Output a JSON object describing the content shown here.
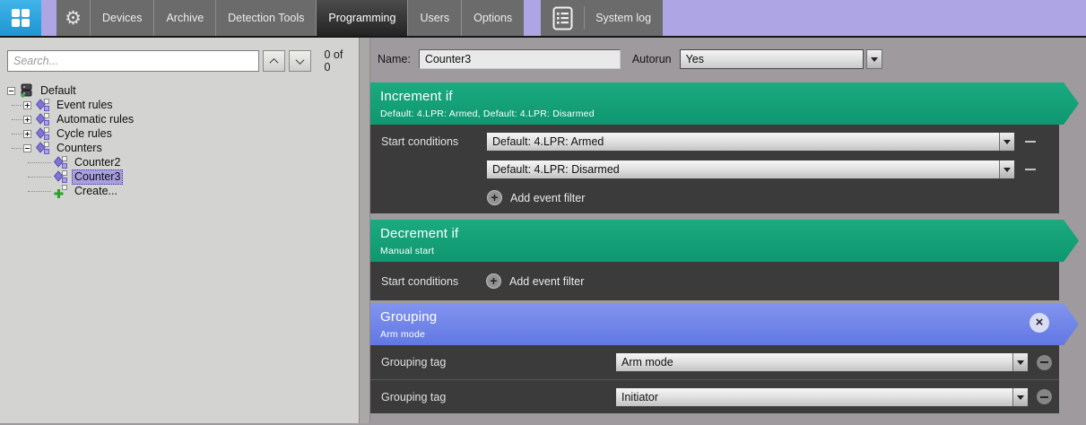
{
  "topbar": {
    "tabs": [
      {
        "label": "Devices"
      },
      {
        "label": "Archive"
      },
      {
        "label": "Detection Tools"
      },
      {
        "label": "Programming",
        "active": true
      },
      {
        "label": "Users"
      },
      {
        "label": "Options"
      }
    ],
    "system_log_label": "System log",
    "icons": [
      "app-grid-icon",
      "gear-icon",
      "system-log-icon"
    ]
  },
  "search": {
    "placeholder": "Search...",
    "count": "0 of 0"
  },
  "tree": {
    "items": [
      {
        "label": "Default",
        "depth": 0,
        "icon": "server-icon",
        "expander": "minus"
      },
      {
        "label": "Event rules",
        "depth": 1,
        "icon": "rule-icon",
        "expander": "plus"
      },
      {
        "label": "Automatic rules",
        "depth": 1,
        "icon": "rule-icon",
        "expander": "plus"
      },
      {
        "label": "Cycle rules",
        "depth": 1,
        "icon": "rule-icon",
        "expander": "plus"
      },
      {
        "label": "Counters",
        "depth": 1,
        "icon": "rule-icon",
        "expander": "minus"
      },
      {
        "label": "Counter2",
        "depth": 2,
        "icon": "rule-icon",
        "expander": "none"
      },
      {
        "label": "Counter3",
        "depth": 2,
        "icon": "rule-icon",
        "expander": "none",
        "selected": true
      },
      {
        "label": "Create...",
        "depth": 2,
        "icon": "create-icon",
        "expander": "none"
      }
    ]
  },
  "properties": {
    "name_label": "Name:",
    "name_value": "Counter3",
    "autorun_label": "Autorun",
    "autorun_value": "Yes"
  },
  "sections": {
    "increment": {
      "title": "Increment if",
      "subtitle": "Default: 4.LPR: Armed, Default: 4.LPR: Disarmed",
      "start_label": "Start conditions",
      "conditions": [
        "Default: 4.LPR: Armed",
        "Default: 4.LPR: Disarmed"
      ],
      "add_label": "Add event filter"
    },
    "decrement": {
      "title": "Decrement if",
      "subtitle": "Manual start",
      "start_label": "Start conditions",
      "add_label": "Add event filter"
    },
    "grouping": {
      "title": "Grouping",
      "subtitle": "Arm mode",
      "rows": [
        {
          "label": "Grouping tag",
          "value": "Arm mode"
        },
        {
          "label": "Grouping tag",
          "value": "Initiator"
        }
      ]
    }
  },
  "colors": {
    "topbar_purple": "#ada5e4",
    "logo_blue": "#2da7e0",
    "tab_gray": "#6b6b6b",
    "active_tab": "#2a2a2a",
    "header_green": "#109b74",
    "header_blue": "#6e83e8",
    "section_body": "#3b3b3b",
    "tree_selection": "#a89fe0",
    "left_panel_bg": "#d3d3d1",
    "right_panel_bg": "#9e9a9e"
  }
}
